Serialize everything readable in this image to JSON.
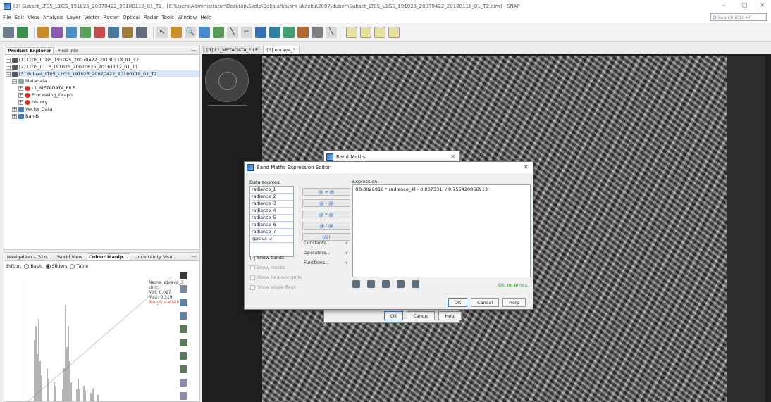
{
  "window": {
    "title": "[3] Subset_LT05_L1GS_191025_20070422_20180118_01_T2 - [C:\\Users\\Administrator\\Desktop\\Škola\\Bakalářka\\pro ukázku\\2007\\duben\\Subset_LT05_L1GS_191025_20070422_20180118_01_T2.dim] - SNAP",
    "minimize": "–",
    "maximize": "▢",
    "close": "✕"
  },
  "menu": [
    "File",
    "Edit",
    "View",
    "Analysis",
    "Layer",
    "Vector",
    "Raster",
    "Optical",
    "Radar",
    "Tools",
    "Window",
    "Help"
  ],
  "search": {
    "placeholder": "Search (Ctrl+I)",
    "icon": "search-icon"
  },
  "product_explorer": {
    "tabs": [
      "Product Explorer",
      "Pixel Info"
    ],
    "items": [
      {
        "label": "[1] LT05_L1GS_191025_20070422_20180118_01_T2",
        "level": 0,
        "icon": "product-icon",
        "expand": "+"
      },
      {
        "label": "[2] LT05_L1TP_191025_20070625_20161112_01_T1",
        "level": 0,
        "icon": "product-icon",
        "expand": "+"
      },
      {
        "label": "[3] Subset_LT05_L1GS_191025_20070422_20180118_01_T2",
        "level": 0,
        "icon": "product-icon",
        "expand": "−",
        "selected": true
      },
      {
        "label": "Metadata",
        "level": 1,
        "icon": "metadata-icon",
        "expand": "−"
      },
      {
        "label": "L1_METADATA_FILE",
        "level": 2,
        "icon": "element-icon",
        "expand": "+"
      },
      {
        "label": "Processing_Graph",
        "level": 2,
        "icon": "element-icon",
        "expand": "+"
      },
      {
        "label": "history",
        "level": 2,
        "icon": "element-icon",
        "expand": "+"
      },
      {
        "label": "Vector Data",
        "level": 1,
        "icon": "folder-icon",
        "expand": "+"
      },
      {
        "label": "Bands",
        "level": 1,
        "icon": "folder-icon",
        "expand": "+"
      }
    ]
  },
  "nav_panel": {
    "tabs": [
      "Navigation - [3] o...",
      "World View",
      "Colour Manip...",
      "Uncertainty Visu..."
    ],
    "editor_label": "Editor:",
    "editor_options": [
      "Basic",
      "Sliders",
      "Table"
    ],
    "editor_selected": "Sliders",
    "stats": {
      "name": "Name: oprava_3",
      "unit": "Unit:",
      "min": "Min: 0.027",
      "max": "Max: 0.319",
      "rough": "Rough statistics!"
    }
  },
  "view_tabs": [
    "[3] L1_METADATA_FILE",
    "[3] oprava_3"
  ],
  "band_maths": {
    "title": "Band Maths",
    "ok": "OK",
    "cancel": "Cancel",
    "help": "Help"
  },
  "expression_editor": {
    "title": "Band Maths Expression Editor",
    "data_sources_label": "Data sources:",
    "sources": [
      "radiance_1",
      "radiance_2",
      "radiance_3",
      "radiance_4",
      "radiance_5",
      "radiance_6",
      "radiance_7",
      "oprava_3"
    ],
    "operators": [
      "@ + @",
      "@ - @",
      "@ * @",
      "@ / @",
      "(@)"
    ],
    "dropdowns": [
      "Constants...",
      "Operators...",
      "Functions..."
    ],
    "checkboxes": [
      {
        "label": "Show bands",
        "checked": true,
        "enabled": true
      },
      {
        "label": "Show masks",
        "checked": false,
        "enabled": false
      },
      {
        "label": "Show tie-point grids",
        "checked": false,
        "enabled": false
      },
      {
        "label": "Show single flags",
        "checked": false,
        "enabled": false
      }
    ],
    "expression_label": "Expression:",
    "expression": "((0.0026916 * radiance_4) - 0.007331) / 0.755420866913",
    "status": "Ok, no errors.",
    "ok": "OK",
    "cancel": "Cancel",
    "help": "Help"
  },
  "colors": {
    "accent": "#1a5dab",
    "ok_status": "#2e8b2e",
    "warning": "#c0392b"
  }
}
